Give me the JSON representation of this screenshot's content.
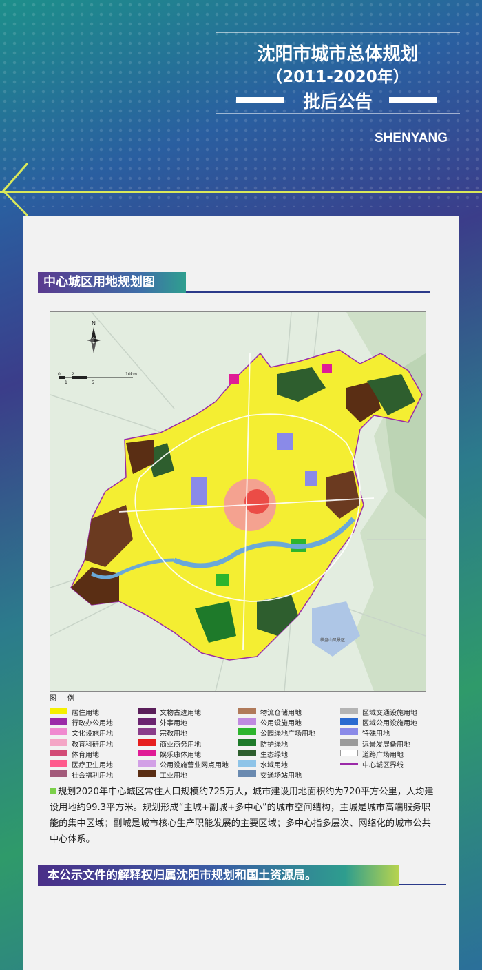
{
  "header": {
    "title_line1": "沈阳市城市总体规划",
    "title_line2": "（2011-2020年）",
    "title_line3": "批后公告",
    "city_en": "SHENYANG",
    "back_icon": "arrow-left-icon"
  },
  "section": {
    "title": "中心城区用地规划图"
  },
  "map": {
    "north_label": "N",
    "scale_top": [
      "0",
      "2",
      "10km"
    ],
    "scale_bottom": [
      "1",
      "5"
    ],
    "lake_label": "棋盘山风景区"
  },
  "legend": {
    "title": "图　例",
    "items": [
      {
        "label": "居住用地",
        "color": "#f5f000"
      },
      {
        "label": "行政办公用地",
        "color": "#9b2aa8"
      },
      {
        "label": "文化设施用地",
        "color": "#f08ad0"
      },
      {
        "label": "教育科研用地",
        "color": "#f4a6c6"
      },
      {
        "label": "体育用地",
        "color": "#d24b76"
      },
      {
        "label": "医疗卫生用地",
        "color": "#ff5a8c"
      },
      {
        "label": "社会福利用地",
        "color": "#a25a7a"
      },
      {
        "label": "文物古迹用地",
        "color": "#5a1e5a"
      },
      {
        "label": "外事用地",
        "color": "#6b2470"
      },
      {
        "label": "宗教用地",
        "color": "#8a3d8a"
      },
      {
        "label": "商业商务用地",
        "color": "#e61e1e"
      },
      {
        "label": "娱乐康体用地",
        "color": "#e01c96"
      },
      {
        "label": "公用设施营业网点用地",
        "color": "#d2a0e6"
      },
      {
        "label": "工业用地",
        "color": "#5a2e14"
      },
      {
        "label": "物流仓储用地",
        "color": "#b07a5a"
      },
      {
        "label": "公用设施用地",
        "color": "#c08ae0"
      },
      {
        "label": "公园绿地广场用地",
        "color": "#2db52d"
      },
      {
        "label": "防护绿地",
        "color": "#1e7a2a"
      },
      {
        "label": "生态绿地",
        "color": "#2e5e2e"
      },
      {
        "label": "水域用地",
        "color": "#8ec4e8"
      },
      {
        "label": "交通场站用地",
        "color": "#6a8ab0"
      },
      {
        "label": "区域交通设施用地",
        "color": "#b4b4b4"
      },
      {
        "label": "区域公用设施用地",
        "color": "#2a6ad0"
      },
      {
        "label": "特殊用地",
        "color": "#8a8ae8"
      },
      {
        "label": "远景发展备用地",
        "color": "#9a9a9a"
      },
      {
        "label": "道路广场用地",
        "color": "#ffffff"
      },
      {
        "label": "中心城区界线",
        "color": "#9b2aa8"
      }
    ]
  },
  "description": "规划2020年中心城区常住人口规模约725万人，城市建设用地面积约为720平方公里，人均建设用地约99.3平方米。规划形成“主城+副城+多中心”的城市空间结构，主城是城市高端服务职能的集中区域；副城是城市核心生产职能发展的主要区域；多中心指多层次、网络化的城市公共中心体系。",
  "footer": {
    "notice": "本公示文件的解释权归属沈阳市规划和国土资源局。"
  }
}
